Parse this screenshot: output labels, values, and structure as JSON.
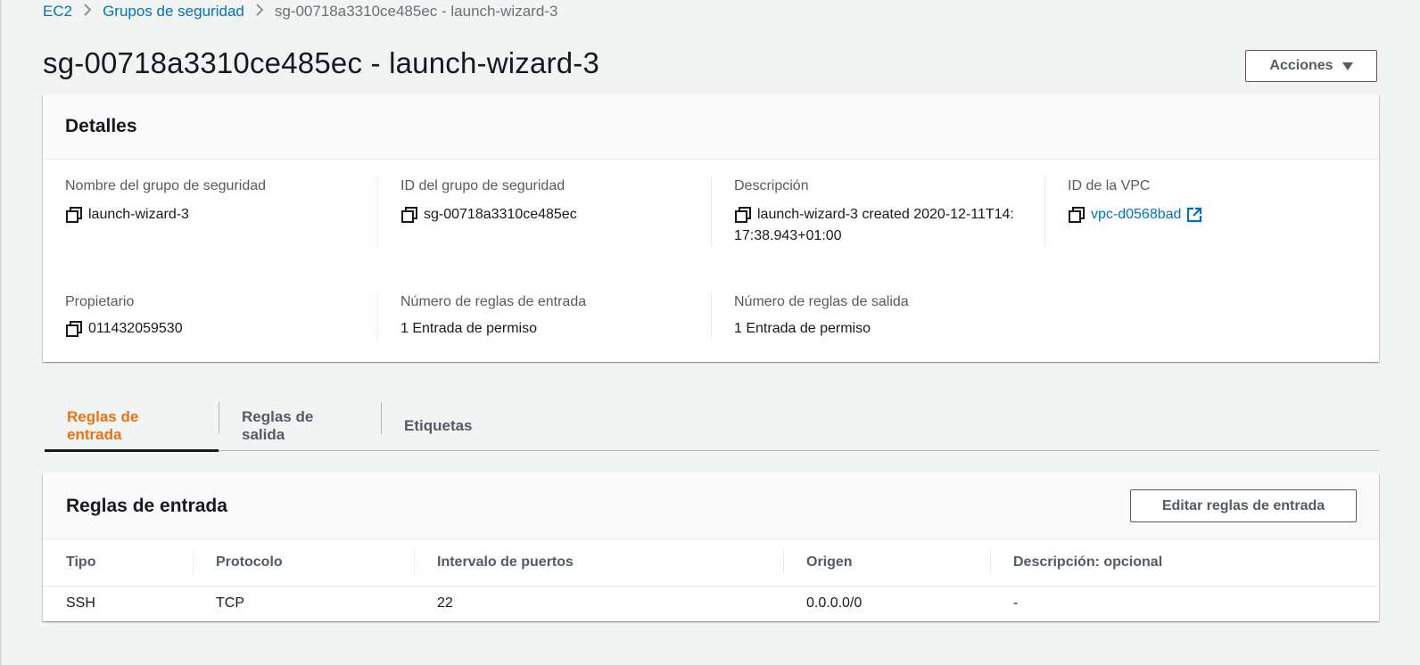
{
  "breadcrumb": {
    "items": [
      "EC2",
      "Grupos de seguridad"
    ],
    "current": "sg-00718a3310ce485ec - launch-wizard-3"
  },
  "page": {
    "title": "sg-00718a3310ce485ec - launch-wizard-3",
    "actions_label": "Acciones"
  },
  "details": {
    "heading": "Detalles",
    "fields": {
      "name": {
        "label": "Nombre del grupo de seguridad",
        "value": "launch-wizard-3"
      },
      "sg_id": {
        "label": "ID del grupo de seguridad",
        "value": "sg-00718a3310ce485ec"
      },
      "description": {
        "label": "Descripción",
        "value": "launch-wizard-3 created 2020-12-11T14:17:38.943+01:00"
      },
      "vpc_id": {
        "label": "ID de la VPC",
        "value": "vpc-d0568bad"
      },
      "owner": {
        "label": "Propietario",
        "value": "011432059530"
      },
      "inbound_count": {
        "label": "Número de reglas de entrada",
        "value": "1 Entrada de permiso"
      },
      "outbound_count": {
        "label": "Número de reglas de salida",
        "value": "1 Entrada de permiso"
      }
    }
  },
  "tabs": [
    {
      "label": "Reglas de entrada",
      "active": true
    },
    {
      "label": "Reglas de salida",
      "active": false
    },
    {
      "label": "Etiquetas",
      "active": false
    }
  ],
  "inbound_rules": {
    "heading": "Reglas de entrada",
    "edit_label": "Editar reglas de entrada",
    "columns": [
      "Tipo",
      "Protocolo",
      "Intervalo de puertos",
      "Origen",
      "Descripción: opcional"
    ],
    "rows": [
      [
        "SSH",
        "TCP",
        "22",
        "0.0.0.0/0",
        "-"
      ]
    ]
  },
  "colors": {
    "link": "#0073bb",
    "active_tab": "#ec7211",
    "background": "#f2f3f3"
  }
}
